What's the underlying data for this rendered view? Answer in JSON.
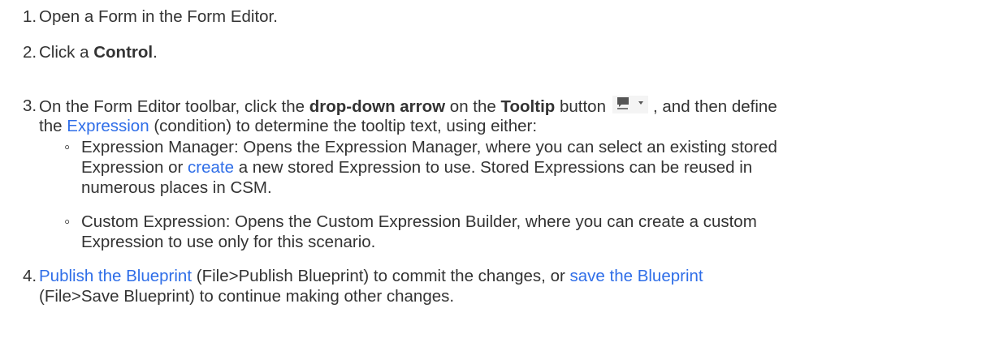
{
  "colors": {
    "text": "#333333",
    "link": "#2f6ee8",
    "icon": "#555555"
  },
  "steps": [
    {
      "number": "1.",
      "text": "Open a Form in the Form Editor."
    },
    {
      "number": "2.",
      "pre": "Click a ",
      "bold": "Control",
      "post": "."
    },
    {
      "number": "3.",
      "line1": {
        "a": "On the Form Editor toolbar, click the ",
        "b1": "drop-down arrow",
        "c": " on the ",
        "b2": "Tooltip",
        "d": " button",
        "e": ", and then define"
      },
      "line2": {
        "a": "the ",
        "link": "Expression",
        "b": " (condition) to determine the tooltip text, using either:"
      },
      "icon": "tooltip-comment-dropdown-icon",
      "bullets": [
        {
          "mark": "◦",
          "line1": "Expression Manager: Opens the Expression Manager, where you can select an existing stored",
          "line2_a": "Expression or ",
          "line2_link": "create",
          "line2_b": " a new stored Expression to use. Stored Expressions can be reused in",
          "line3": "numerous places in CSM."
        },
        {
          "mark": "◦",
          "line1": "Custom Expression: Opens the Custom Expression Builder, where you can create a custom",
          "line2": "Expression to use only for this scenario."
        }
      ]
    },
    {
      "number": "4.",
      "link1": "Publish the Blueprint",
      "mid": " (File>Publish Blueprint) to commit the changes, or ",
      "link2": "save the Blueprint",
      "line2": "(File>Save Blueprint) to continue making other changes."
    }
  ]
}
